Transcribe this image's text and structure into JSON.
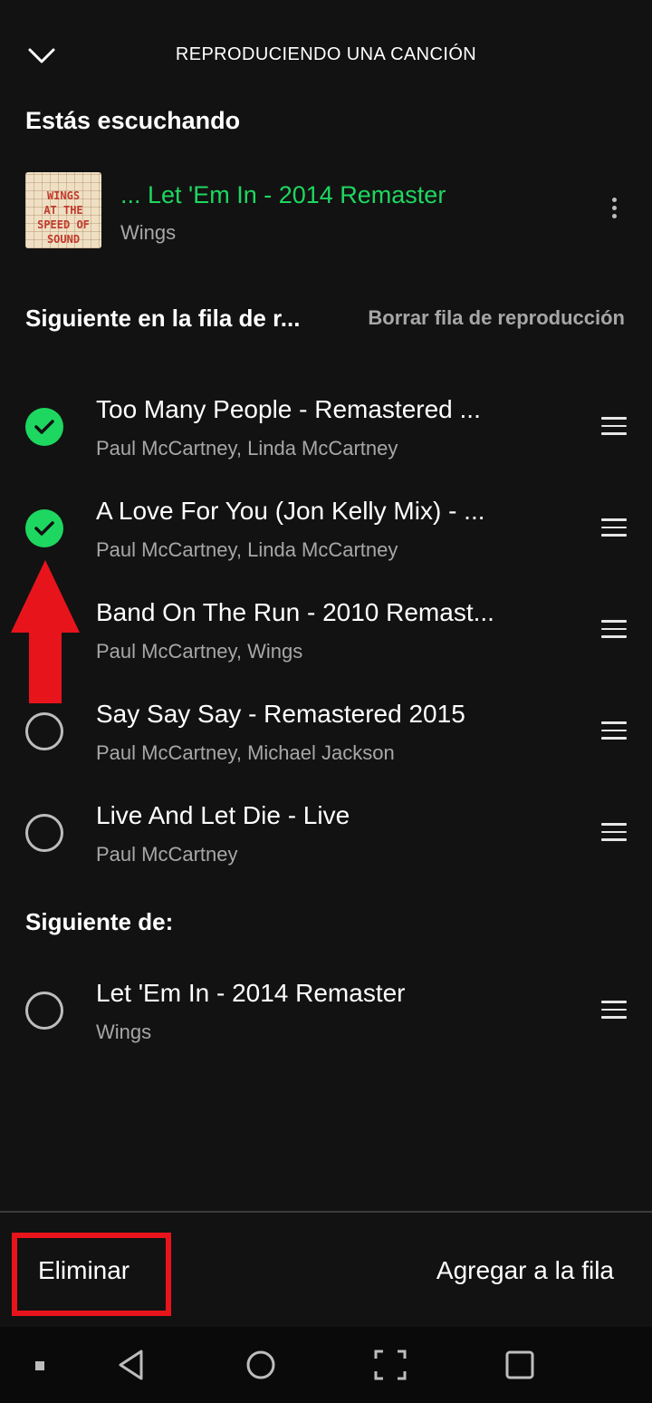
{
  "header": {
    "title": "REPRODUCIENDO UNA CANCIÓN",
    "collapse_icon": "chevron-down-icon"
  },
  "now_playing": {
    "section_title": "Estás escuchando",
    "title": "... Let 'Em In - 2014 Remaster",
    "artist": "Wings",
    "cover_text": [
      "WINGS",
      "AT THE",
      "SPEED OF",
      "SOUND"
    ],
    "title_color": "#1ed760",
    "more_icon": "more-vertical-icon"
  },
  "queue": {
    "section_title": "Siguiente en la fila de r...",
    "clear_label": "Borrar fila de reproducción",
    "tracks": [
      {
        "title": "Too Many People - Remastered ...",
        "artist": "Paul McCartney, Linda McCartney",
        "selected": true
      },
      {
        "title": "A Love For You (Jon Kelly Mix) - ...",
        "artist": "Paul McCartney, Linda McCartney",
        "selected": true
      },
      {
        "title": "Band On The Run - 2010 Remast...",
        "artist": "Paul McCartney, Wings",
        "selected": false
      },
      {
        "title": "Say Say Say - Remastered 2015",
        "artist": "Paul McCartney, Michael Jackson",
        "selected": false
      },
      {
        "title": "Live And Let Die - Live",
        "artist": "Paul McCartney",
        "selected": false
      }
    ]
  },
  "next_from": {
    "section_title": "Siguiente de:",
    "tracks": [
      {
        "title": "Let 'Em In - 2014 Remaster",
        "artist": "Wings",
        "selected": false
      }
    ]
  },
  "bottom_bar": {
    "remove_label": "Eliminar",
    "add_label": "Agregar a la fila"
  },
  "annotations": {
    "arrow_color": "#e8141c",
    "highlight_color": "#e8141c"
  },
  "colors": {
    "accent": "#1ed760",
    "background": "#121212",
    "secondary_text": "#a7a7a7"
  },
  "system_nav": [
    "menu-dot-icon",
    "back-icon",
    "home-icon",
    "screenshot-icon",
    "recents-icon"
  ]
}
